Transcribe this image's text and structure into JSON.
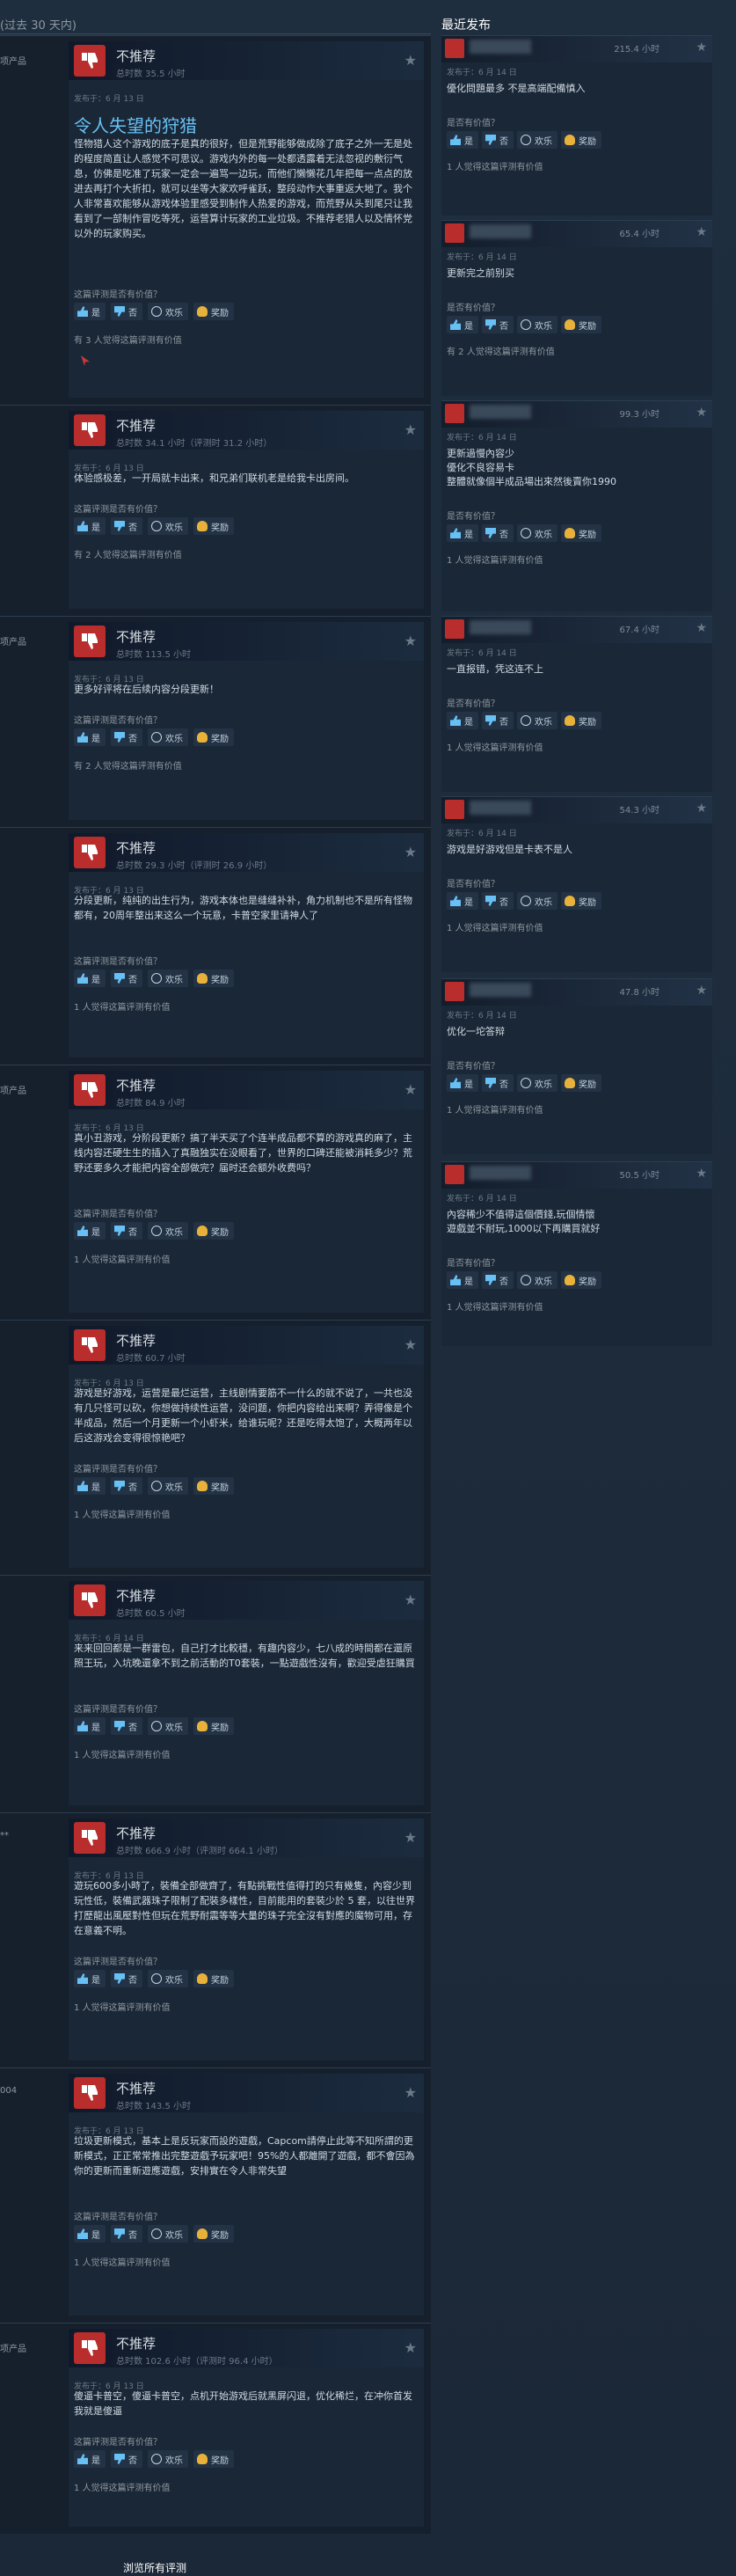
{
  "range_label": "(过去 30 天内)",
  "recent_title": "最近发布",
  "view_all": "浏览所有评测",
  "vote_labels": {
    "yes": "是",
    "no": "否",
    "funny": "欢乐",
    "award": "奖励"
  },
  "helpful_question": "这篇评测是否有价值？",
  "recent_helpful_question": "是否有价值？",
  "colors": {
    "not_recommended": "#b92d2d",
    "accent": "#67c1f5",
    "background": "#1b2838"
  },
  "reviews": [
    {
      "side_tag": "项产品",
      "verdict": "不推荐",
      "hours": "总时数 35.5 小时",
      "posted": "发布于：6 月 13 日",
      "title": "令人失望的狩猎",
      "text": "怪物猎人这个游戏的底子是真的很好，但是荒野能够做成除了底子之外一无是处的程度简直让人感觉不可思议。游戏内外的每一处都透露着无法忽视的敷衍气息，仿佛是吃准了玩家一定会一遍骂一边玩，而他们懒懒花几年把每一点点的放进去再打个大折扣，就可以坐等大家欢呼雀跃，整段动作大事重返大地了。我个人非常喜欢能够从游戏体验里感受到制作人热爱的游戏，而荒野从头到尾只让我看到了一部制作冒吃等死，运营算计玩家的工业垃圾。不推荐老猎人以及情怀党以外的玩家购买。",
      "found": "有 3 人觉得这篇评测有价值"
    },
    {
      "side_tag": "",
      "verdict": "不推荐",
      "hours": "总时数 34.1 小时（评测时 31.2 小时）",
      "posted": "发布于：6 月 13 日",
      "text": "体验感极差，一开局就卡出来，和兄弟们联机老是给我卡出房间。",
      "found": "有 2 人觉得这篇评测有价值"
    },
    {
      "side_tag": "项产品",
      "verdict": "不推荐",
      "hours": "总时数 113.5 小时",
      "posted": "发布于：6 月 13 日",
      "text": "更多好评将在后续内容分段更新！",
      "found": "有 2 人觉得这篇评测有价值"
    },
    {
      "side_tag": "",
      "verdict": "不推荐",
      "hours": "总时数 29.3 小时（评测时 26.9 小时）",
      "posted": "发布于：6 月 13 日",
      "text": "分段更新，纯纯的出生行为，游戏本体也是缝缝补补，角力机制也不是所有怪物都有，20周年整出来这么一个玩意，卡普空家里请神人了",
      "found": "1 人觉得这篇评测有价值"
    },
    {
      "side_tag": "项产品",
      "verdict": "不推荐",
      "hours": "总时数 84.9 小时",
      "posted": "发布于：6 月 13 日",
      "text": "真小丑游戏，分阶段更新？搞了半天买了个连半成品都不算的游戏真的麻了，主线内容还硬生生的插入了真融独实在没眼看了，世界的口碑还能被消耗多少？荒野还要多久才能把内容全部做完？届时还会额外收费吗？",
      "found": "1 人觉得这篇评测有价值"
    },
    {
      "side_tag": "",
      "verdict": "不推荐",
      "hours": "总时数 60.7 小时",
      "posted": "发布于：6 月 13 日",
      "text": "游戏是好游戏，运营是最烂运营，主线剧情要筋不一什么的就不说了，一共也没有几只怪可以砍，你想做持续性运营，没问题，你把内容给出来啊？弄得像是个半成品，然后一个月更新一个小虾米，给谁玩呢？还是吃得太饱了，大概两年以后这游戏会变得很惊艳吧？",
      "found": "1 人觉得这篇评测有价值"
    },
    {
      "side_tag": "",
      "verdict": "不推荐",
      "hours": "总时数 60.5 小时",
      "posted": "发布于：6 月 14 日",
      "text": "来来回回都是一群雷包，自己打才比較穩，有趣内容少，七八成的時間都在還原照王玩，入坑晚還拿不到之前活動的T0套裝，一點遊戲性沒有，歡迎受虐狂購買",
      "found": "1 人觉得这篇评测有价值"
    },
    {
      "side_tag": "**",
      "verdict": "不推荐",
      "hours": "总时数 666.9 小时（评测时 664.1 小时）",
      "posted": "发布于：6 月 13 日",
      "text": "遊玩600多小時了，裝備全部做齊了，有點挑戰性值得打的只有幾隻，內容少到玩性低，裝備武器珠子限制了配裝多樣性，目前能用的套裝少於 5 套，以往世界打歷龍出風壓對性但玩在荒野耐震等等大量的珠子完全沒有對應的魔物可用，存在意義不明。",
      "found": "1 人觉得这篇评测有价值"
    },
    {
      "side_tag": "004",
      "verdict": "不推荐",
      "hours": "总时数 143.5 小时",
      "posted": "发布于：6 月 13 日",
      "text": "垃圾更新模式，基本上是反玩家而設的遊戲，Capcom請停止此等不知所謂的更新模式，正正常常推出完整遊戲予玩家吧！95%的人都離開了遊戲，都不會因為你的更新而重新遊應遊戲，安排實在令人非常失望",
      "found": "1 人觉得这篇评测有价值"
    },
    {
      "side_tag": "项产品",
      "verdict": "不推荐",
      "hours": "总时数 102.6 小时（评测时 96.4 小时）",
      "posted": "发布于：6 月 13 日",
      "text": "傻逼卡普空，傻逼卡普空，点机开始游戏后就黑屏闪退，优化稀烂，在冲你首发我就是傻逼",
      "found": "1 人觉得这篇评测有价值"
    }
  ],
  "recent": [
    {
      "hours": "215.4 小时",
      "posted": "发布于：6 月 14 日",
      "text": "優化問題最多 不是高端配備慎入",
      "found": "1 人觉得这篇评测有价值"
    },
    {
      "hours": "65.4 小时",
      "posted": "发布于：6 月 14 日",
      "text": "更新完之前别买",
      "found": "有 2 人觉得这篇评测有价值"
    },
    {
      "hours": "99.3 小时",
      "posted": "发布于：6 月 14 日",
      "text": "更新過慢內容少\n優化不良容易卡\n整體就像個半成品場出來然後賣你1990",
      "found": "1 人觉得这篇评测有价值"
    },
    {
      "hours": "67.4 小时",
      "posted": "发布于：6 月 14 日",
      "text": "一直报错，凭这连不上",
      "found": "1 人觉得这篇评测有价值"
    },
    {
      "hours": "54.3 小时",
      "posted": "发布于：6 月 14 日",
      "text": "游戏是好游戏但是卡表不是人",
      "found": "1 人觉得这篇评测有价值"
    },
    {
      "hours": "47.8 小时",
      "posted": "发布于：6 月 14 日",
      "text": "优化一坨答辩",
      "found": "1 人觉得这篇评测有价值"
    },
    {
      "hours": "50.5 小时",
      "posted": "发布于：6 月 14 日",
      "text": "內容稀少不值得這個價錢,玩個情懷\n遊戲並不耐玩,1000以下再購買就好",
      "found": "1 人觉得这篇评测有价值"
    }
  ]
}
